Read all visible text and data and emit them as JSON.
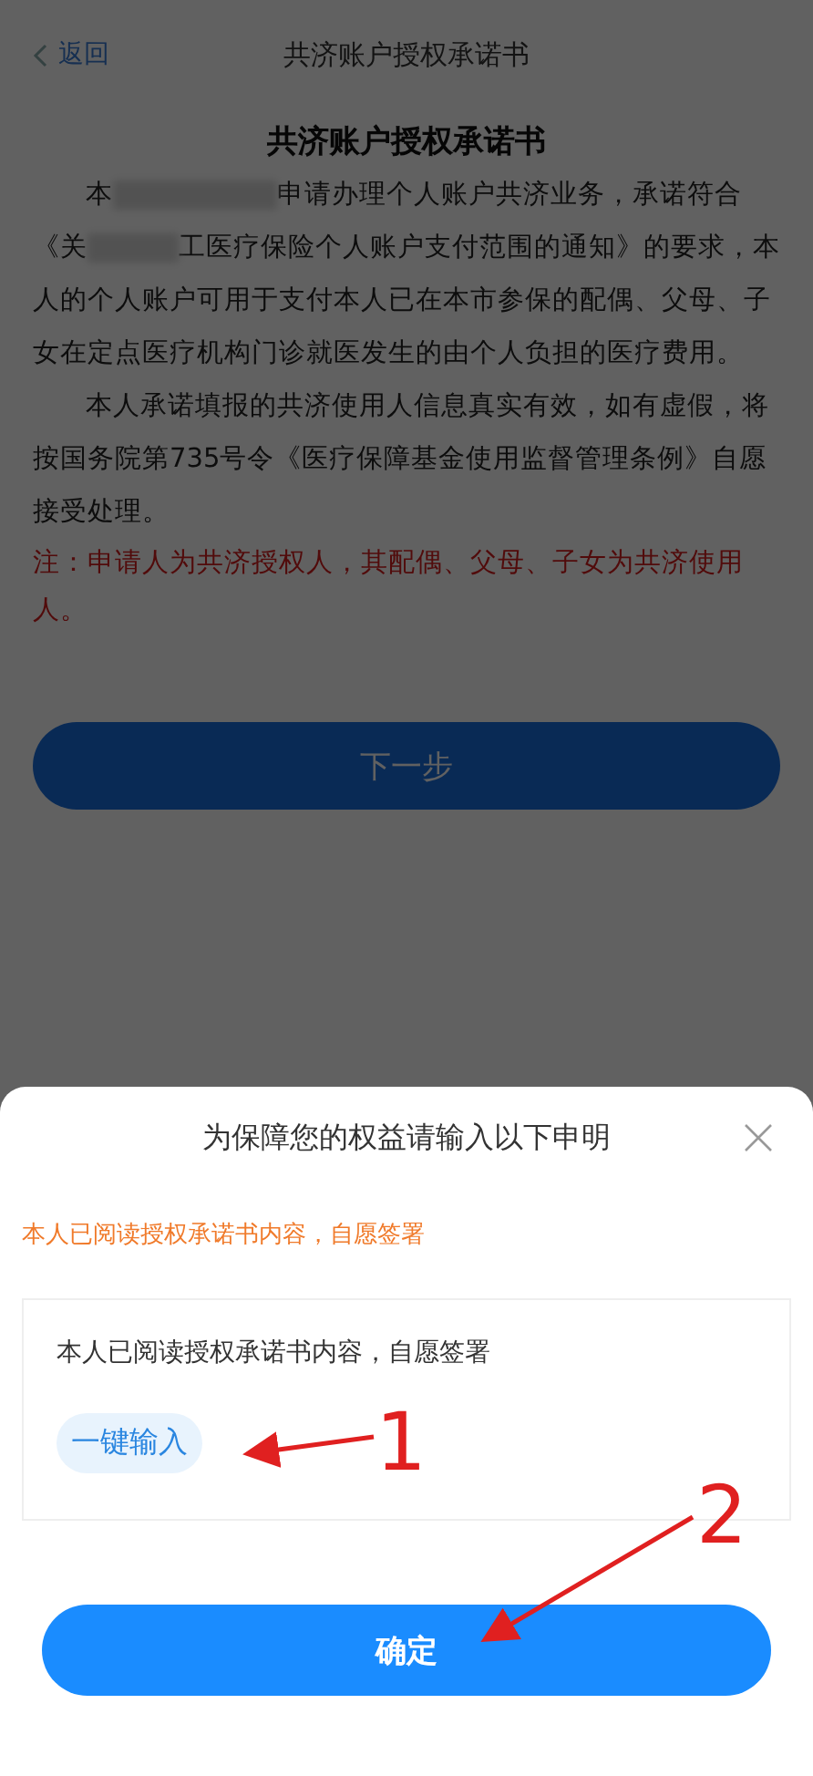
{
  "header": {
    "back": "返回",
    "title": "共济账户授权承诺书"
  },
  "document": {
    "title": "共济账户授权承诺书",
    "paragraph_1_parts": [
      "本",
      "申请办理个人账户共济业务，承诺符合《关",
      "工医疗保险个人账户支付范围的通知》的要求，本人的个人账户可用于支付本人已在本市参保的配偶、父母、子女在定点医疗机构门诊就医发生的由个人负担的医疗费用。"
    ],
    "paragraph_2": "本人承诺填报的共济使用人信息真实有效，如有虚假，将按国务院第735号令《医疗保障基金使用监督管理条例》自愿接受处理。",
    "note": "注：申请人为共济授权人，其配偶、父母、子女为共济使用人。"
  },
  "next_button": "下一步",
  "dialog": {
    "title": "为保障您的权益请输入以下申明",
    "statement": "本人已阅读授权承诺书内容，自愿签署",
    "input_value": "本人已阅读授权承诺书内容，自愿签署",
    "quick_input": "一键输入",
    "confirm": "确定"
  },
  "annotations": [
    {
      "label": "1"
    },
    {
      "label": "2"
    }
  ]
}
